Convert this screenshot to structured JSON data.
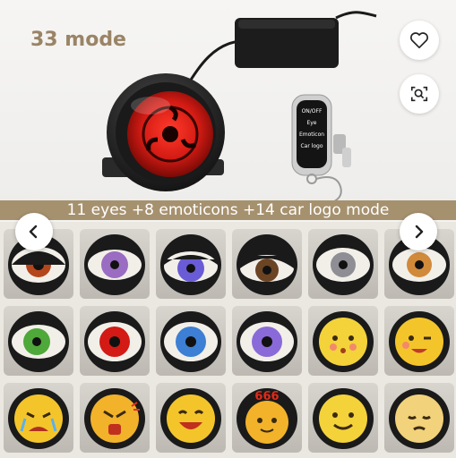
{
  "product_gallery": {
    "mode_count_text": "33 mode",
    "banner_text": "11 eyes +8 emoticons +14 car logo mode",
    "remote_labels": [
      "ON/OFF",
      "Eye",
      "Emoticon",
      "Car logo"
    ],
    "wishlist_icon": "heart-icon",
    "image_search_icon": "camera-search-icon",
    "prev_icon": "chevron-left-icon",
    "next_icon": "chevron-right-icon",
    "thumbnail_captions": {
      "emoticon_666": "666"
    },
    "colors": {
      "accent_text": "#9a8466",
      "banner_bg": "#a6916f",
      "device_red": "#d41b14"
    }
  }
}
